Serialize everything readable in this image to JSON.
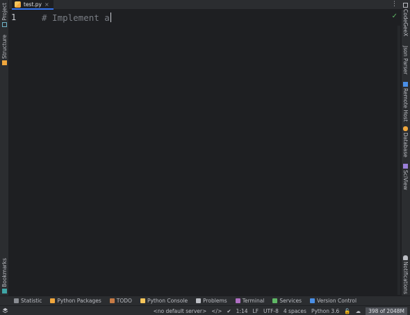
{
  "left_strip": {
    "project": "Project",
    "structure": "Structure",
    "bookmarks": "Bookmarks"
  },
  "right_strip": {
    "codegeex": "CodeGeeX",
    "json_parser": "Json Parser",
    "remote_host": "Remote Host",
    "database": "Database",
    "sciview": "SciView",
    "notifications": "Notifications"
  },
  "tabs": [
    {
      "label": "test.py"
    }
  ],
  "editor": {
    "line_number": "1",
    "code": "# Implement a"
  },
  "tool_windows": [
    {
      "label": "Statistic",
      "icon": "statistic-icon",
      "color": "#8a8d93"
    },
    {
      "label": "Python Packages",
      "icon": "python-packages-icon",
      "color": "#f0a73d"
    },
    {
      "label": "TODO",
      "icon": "todo-icon",
      "color": "#c77b45"
    },
    {
      "label": "Python Console",
      "icon": "python-console-icon",
      "color": "#f5c55a"
    },
    {
      "label": "Problems",
      "icon": "problems-icon",
      "color": "#bcbec4"
    },
    {
      "label": "Terminal",
      "icon": "terminal-icon",
      "color": "#b06fc4"
    },
    {
      "label": "Services",
      "icon": "services-icon",
      "color": "#5fb865"
    },
    {
      "label": "Version Control",
      "icon": "version-control-icon",
      "color": "#4a8fe7"
    }
  ],
  "status": {
    "server": "<no default server>",
    "position": "1:14",
    "line_sep": "LF",
    "encoding": "UTF-8",
    "indent": "4 spaces",
    "interpreter": "Python 3.6",
    "memory": "398 of 2048M"
  },
  "colors": {
    "accent": "#3574f0",
    "check": "#5fb865"
  }
}
